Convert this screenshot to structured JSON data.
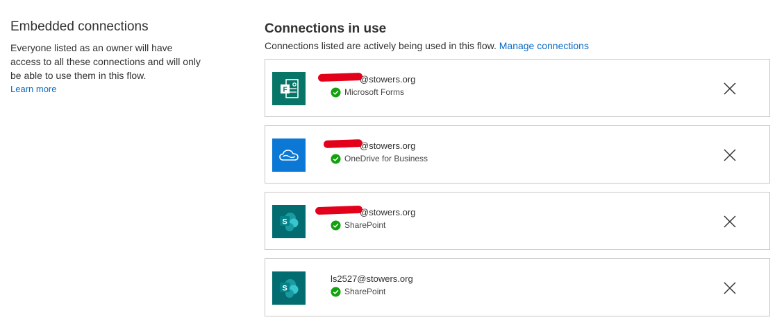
{
  "embedded": {
    "title": "Embedded connections",
    "description": "Everyone listed as an owner will have access to all these connections and will only be able to use them in this flow.",
    "learn_more": "Learn more"
  },
  "in_use": {
    "title": "Connections in use",
    "subtitle": "Connections listed are actively being used in this flow.",
    "manage_link": "Manage connections"
  },
  "connections": [
    {
      "account": "@stowers.org",
      "service": "Microsoft Forms",
      "icon": "microsoft-forms-icon",
      "color": "#077568",
      "redacted": true
    },
    {
      "account": "@stowers.org",
      "service": "OneDrive for Business",
      "icon": "onedrive-icon",
      "color": "#0a78d4",
      "redacted": true
    },
    {
      "account": "@stowers.org",
      "service": "SharePoint",
      "icon": "sharepoint-icon",
      "color": "#036c70",
      "redacted": true
    },
    {
      "account": "ls2527@stowers.org",
      "service": "SharePoint",
      "icon": "sharepoint-icon",
      "color": "#036c70",
      "redacted": false
    }
  ],
  "colors": {
    "link": "#0b6bc4",
    "status_ok": "#13a10e",
    "redaction": "#e3001b"
  }
}
